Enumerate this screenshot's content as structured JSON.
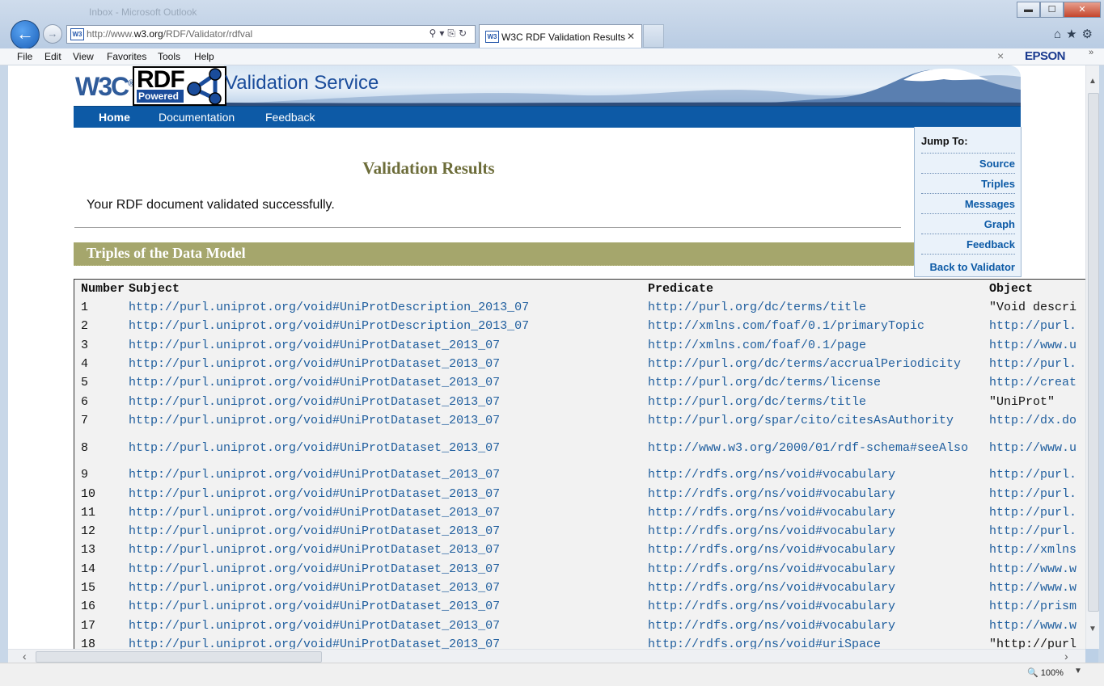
{
  "browser": {
    "ghost_title": "Inbox - Microsoft Outlook",
    "address_url_prefix": "http://www.",
    "address_url_domain": "w3.org",
    "address_url_path": "/RDF/Validator/rdfval",
    "favicon_text": "W3",
    "tab_title": "W3C RDF Validation Results",
    "window_buttons": {
      "minimize": "▬",
      "maximize": "☐",
      "close": "✕"
    },
    "addr_tools": "⚲▾⎘↻",
    "right_icons": "⌂★⚙"
  },
  "menubar": {
    "items": [
      "File",
      "Edit",
      "View",
      "Favorites",
      "Tools",
      "Help"
    ],
    "epson": "EPSON",
    "close_x": "×",
    "chevron": "»"
  },
  "header": {
    "w3c": "W3C",
    "reg": "®",
    "rdf": "RDF",
    "powered": "Powered",
    "site_title": "Validation Service"
  },
  "nav": {
    "items": [
      "Home",
      "Documentation",
      "Feedback"
    ]
  },
  "jumpto": {
    "heading": "Jump To:",
    "links": [
      "Source",
      "Triples",
      "Messages",
      "Graph",
      "Feedback",
      "Back to Validator Input"
    ]
  },
  "content": {
    "results_title": "Validation Results",
    "success_message": "Your RDF document validated successfully.",
    "section_title": "Triples of the Data Model"
  },
  "triples": {
    "columns": [
      "Number",
      "Subject",
      "Predicate",
      "Object"
    ],
    "rows": [
      {
        "n": "1",
        "s": "http://purl.uniprot.org/void#UniProtDescription_2013_07",
        "p": "http://purl.org/dc/terms/title",
        "o": "\"Void descri"
      },
      {
        "n": "2",
        "s": "http://purl.uniprot.org/void#UniProtDescription_2013_07",
        "p": "http://xmlns.com/foaf/0.1/primaryTopic",
        "o": "http://purl."
      },
      {
        "n": "3",
        "s": "http://purl.uniprot.org/void#UniProtDataset_2013_07",
        "p": "http://xmlns.com/foaf/0.1/page",
        "o": "http://www.u"
      },
      {
        "n": "4",
        "s": "http://purl.uniprot.org/void#UniProtDataset_2013_07",
        "p": "http://purl.org/dc/terms/accrualPeriodicity",
        "o": "http://purl."
      },
      {
        "n": "5",
        "s": "http://purl.uniprot.org/void#UniProtDataset_2013_07",
        "p": "http://purl.org/dc/terms/license",
        "o": "http://creat"
      },
      {
        "n": "6",
        "s": "http://purl.uniprot.org/void#UniProtDataset_2013_07",
        "p": "http://purl.org/dc/terms/title",
        "o": "\"UniProt\""
      },
      {
        "n": "7",
        "s": "http://purl.uniprot.org/void#UniProtDataset_2013_07",
        "p": "http://purl.org/spar/cito/citesAsAuthority",
        "o": "http://dx.do"
      },
      {
        "n": "8",
        "s": "http://purl.uniprot.org/void#UniProtDataset_2013_07",
        "p": "http://www.w3.org/2000/01/rdf-schema#seeAlso",
        "o": "http://www.u"
      },
      {
        "n": "9",
        "s": "http://purl.uniprot.org/void#UniProtDataset_2013_07",
        "p": "http://rdfs.org/ns/void#vocabulary",
        "o": "http://purl."
      },
      {
        "n": "10",
        "s": "http://purl.uniprot.org/void#UniProtDataset_2013_07",
        "p": "http://rdfs.org/ns/void#vocabulary",
        "o": "http://purl."
      },
      {
        "n": "11",
        "s": "http://purl.uniprot.org/void#UniProtDataset_2013_07",
        "p": "http://rdfs.org/ns/void#vocabulary",
        "o": "http://purl."
      },
      {
        "n": "12",
        "s": "http://purl.uniprot.org/void#UniProtDataset_2013_07",
        "p": "http://rdfs.org/ns/void#vocabulary",
        "o": "http://purl."
      },
      {
        "n": "13",
        "s": "http://purl.uniprot.org/void#UniProtDataset_2013_07",
        "p": "http://rdfs.org/ns/void#vocabulary",
        "o": "http://xmlns"
      },
      {
        "n": "14",
        "s": "http://purl.uniprot.org/void#UniProtDataset_2013_07",
        "p": "http://rdfs.org/ns/void#vocabulary",
        "o": "http://www.w"
      },
      {
        "n": "15",
        "s": "http://purl.uniprot.org/void#UniProtDataset_2013_07",
        "p": "http://rdfs.org/ns/void#vocabulary",
        "o": "http://www.w"
      },
      {
        "n": "16",
        "s": "http://purl.uniprot.org/void#UniProtDataset_2013_07",
        "p": "http://rdfs.org/ns/void#vocabulary",
        "o": "http://prism"
      },
      {
        "n": "17",
        "s": "http://purl.uniprot.org/void#UniProtDataset_2013_07",
        "p": "http://rdfs.org/ns/void#vocabulary",
        "o": "http://www.w"
      },
      {
        "n": "18",
        "s": "http://purl.uniprot.org/void#UniProtDataset_2013_07",
        "p": "http://rdfs.org/ns/void#uriSpace",
        "o": "\"http://purl"
      }
    ]
  },
  "statusbar": {
    "zoom": "100%",
    "zoom_icon": "🔍"
  },
  "colors": {
    "nav_blue": "#0d5aa6",
    "section_olive": "#a5a66c",
    "title_olive": "#6d6d3a",
    "link_blue": "#1f5e9e"
  }
}
